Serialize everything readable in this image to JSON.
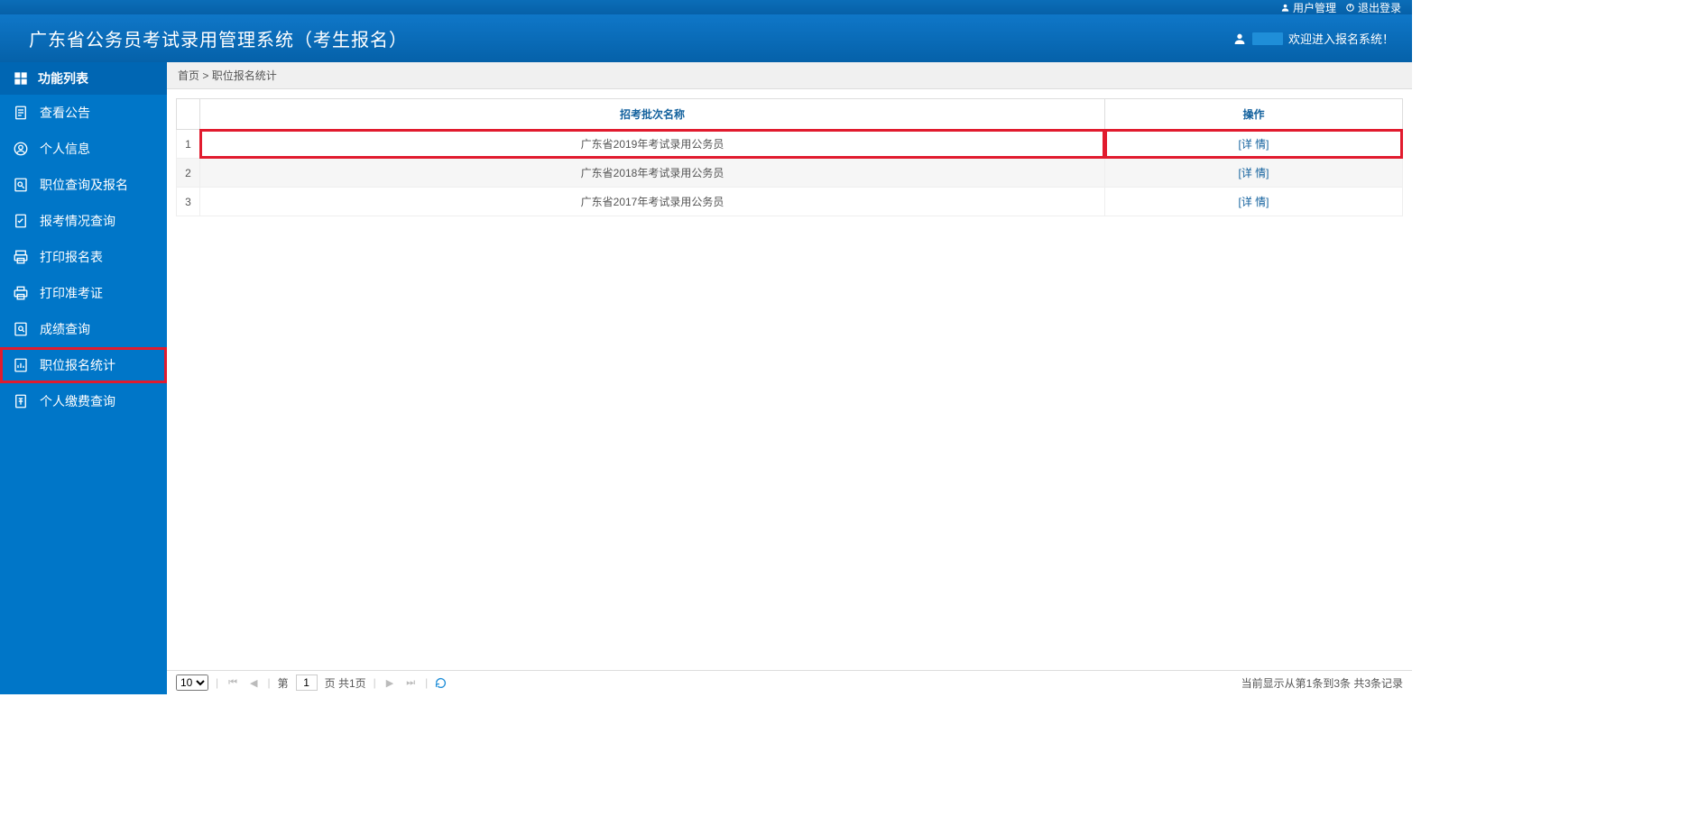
{
  "topbar": {
    "user_mgmt": "用户管理",
    "logout": "退出登录"
  },
  "header": {
    "title": "广东省公务员考试录用管理系统（考生报名）",
    "welcome": "欢迎进入报名系统！"
  },
  "sidebar": {
    "header": "功能列表",
    "items": [
      {
        "label": "查看公告",
        "icon": "file"
      },
      {
        "label": "个人信息",
        "icon": "user"
      },
      {
        "label": "职位查询及报名",
        "icon": "search-doc"
      },
      {
        "label": "报考情况查询",
        "icon": "status-doc"
      },
      {
        "label": "打印报名表",
        "icon": "print-form"
      },
      {
        "label": "打印准考证",
        "icon": "print-cert"
      },
      {
        "label": "成绩查询",
        "icon": "score"
      },
      {
        "label": "职位报名统计",
        "icon": "stats",
        "active": true
      },
      {
        "label": "个人缴费查询",
        "icon": "fee"
      }
    ]
  },
  "breadcrumb": {
    "home": "首页",
    "sep": ">",
    "current": "职位报名统计"
  },
  "table": {
    "headers": {
      "name": "招考批次名称",
      "action": "操作"
    },
    "rows": [
      {
        "idx": "1",
        "name": "广东省2019年考试录用公务员",
        "action": "[详 情]",
        "highlight": true
      },
      {
        "idx": "2",
        "name": "广东省2018年考试录用公务员",
        "action": "[详 情]"
      },
      {
        "idx": "3",
        "name": "广东省2017年考试录用公务员",
        "action": "[详 情]"
      }
    ]
  },
  "pager": {
    "page_size": "10",
    "label_prefix": "第",
    "current_page": "1",
    "label_suffix": "页 共1页",
    "summary": "当前显示从第1条到3条 共3条记录"
  }
}
